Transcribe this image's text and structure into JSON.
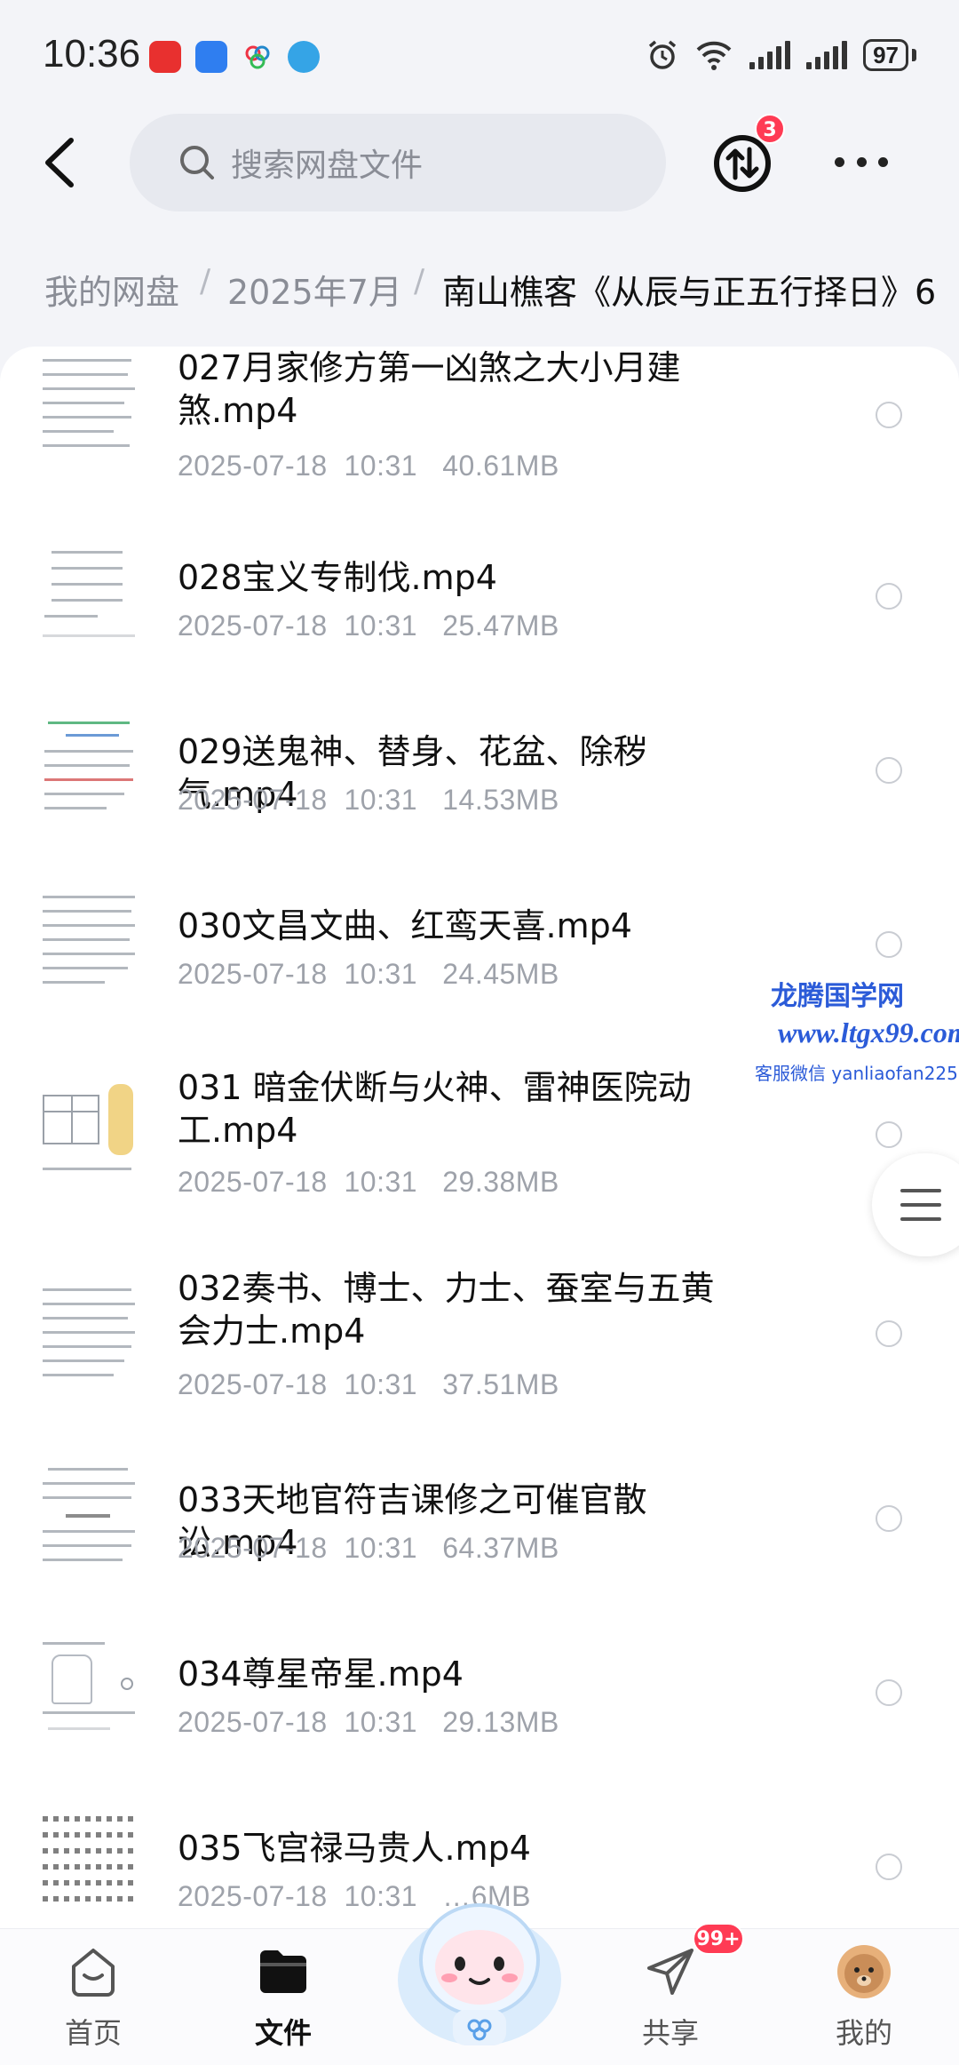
{
  "status_bar": {
    "time": "10:36",
    "battery": "97",
    "app_icons": [
      "huawei-store-icon",
      "app-icon-blue",
      "app-icon-flower",
      "app-icon-telegram"
    ]
  },
  "header": {
    "search_placeholder": "搜索网盘文件",
    "transfer_badge": "3"
  },
  "breadcrumb": [
    "我的网盘",
    "2025年7月",
    "南山樵客《从辰与正五行择日》6"
  ],
  "files": [
    {
      "name": "027月家修方第一凶煞之大小月建煞.mp4",
      "date": "2025-07-18",
      "time": "10:31",
      "size": "40.61MB"
    },
    {
      "name": "028宝义专制伐.mp4",
      "date": "2025-07-18",
      "time": "10:31",
      "size": "25.47MB"
    },
    {
      "name": "029送鬼神、替身、花盆、除秽气.mp4",
      "date": "2025-07-18",
      "time": "10:31",
      "size": "14.53MB"
    },
    {
      "name": "030文昌文曲、红鸾天喜.mp4",
      "date": "2025-07-18",
      "time": "10:31",
      "size": "24.45MB"
    },
    {
      "name": "031 暗金伏断与火神、雷神医院动工.mp4",
      "date": "2025-07-18",
      "time": "10:31",
      "size": "29.38MB"
    },
    {
      "name": "032奏书、博士、力士、蚕室与五黄会力士.mp4",
      "date": "2025-07-18",
      "time": "10:31",
      "size": "37.51MB"
    },
    {
      "name": "033天地官符吉课修之可催官散讼.mp4",
      "date": "2025-07-18",
      "time": "10:31",
      "size": "64.37MB"
    },
    {
      "name": "034尊星帝星.mp4",
      "date": "2025-07-18",
      "time": "10:31",
      "size": "29.13MB"
    },
    {
      "name": "035飞宫禄马贵人.mp4",
      "date": "2025-07-18",
      "time": "10:31",
      "size": "…6MB"
    }
  ],
  "watermark": {
    "title": "龙腾国学网",
    "url": "www.ltgx99.com",
    "service": "客服微信 yanliaofan225"
  },
  "bottom_nav": [
    {
      "label": "首页",
      "icon": "home-icon",
      "active": false
    },
    {
      "label": "文件",
      "icon": "folder-icon",
      "active": true
    },
    {
      "label": "共享",
      "icon": "share-icon",
      "active": false,
      "badge": "99+"
    },
    {
      "label": "我的",
      "icon": "avatar-icon",
      "active": false
    }
  ],
  "colors": {
    "accent_badge": "#ff3b54",
    "watermark": "#2b5bd8",
    "background": "#f3f4f8"
  }
}
